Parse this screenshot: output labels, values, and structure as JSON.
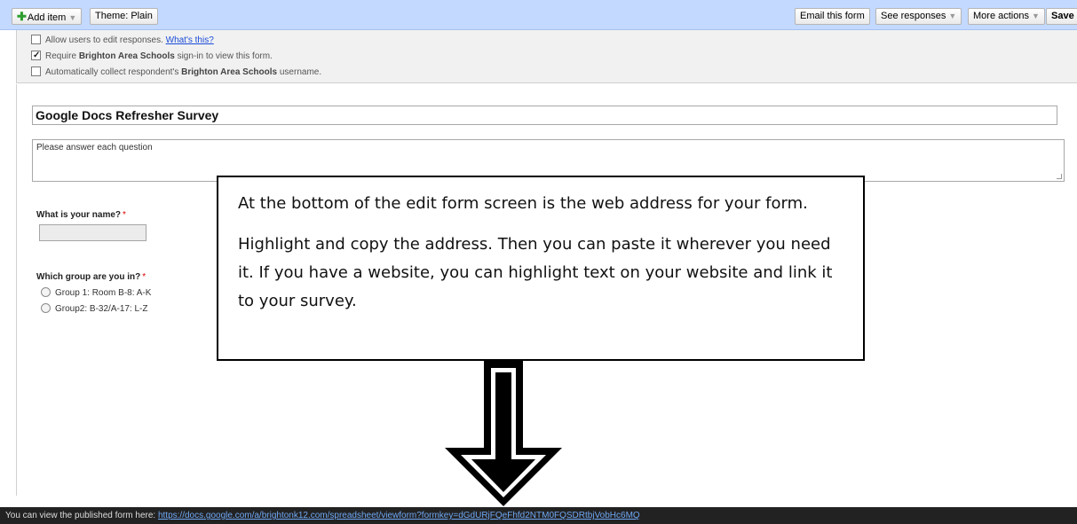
{
  "toolbar": {
    "add_item": "Add item",
    "theme": "Theme: Plain",
    "email_form": "Email this form",
    "see_responses": "See responses",
    "more_actions": "More actions",
    "save": "Save"
  },
  "settings": {
    "allow_edit_prefix": "Allow users to edit responses.",
    "allow_edit_link": "What's this?",
    "allow_edit_checked": false,
    "require_signin_prefix": "Require",
    "require_signin_org": "Brighton Area Schools",
    "require_signin_suffix": "sign-in to view this form.",
    "require_signin_checked": true,
    "collect_prefix": "Automatically collect respondent's",
    "collect_org": "Brighton Area Schools",
    "collect_suffix": "username.",
    "collect_checked": false
  },
  "form": {
    "title": "Google Docs Refresher Survey",
    "description": "Please answer each question",
    "questions": [
      {
        "label": "What is your name?",
        "required_mark": "*"
      },
      {
        "label": "Which group are you in?",
        "required_mark": "*",
        "options": [
          "Group 1: Room B-8: A-K",
          "Group2: B-32/A-17: L-Z"
        ]
      }
    ]
  },
  "callout": {
    "paragraph1": "At the bottom of the edit form screen is the web address for your form.",
    "paragraph2": "Highlight and copy the address. Then you can paste it wherever you need it. If you have a website, you can highlight text on your website and link it to your survey."
  },
  "footer": {
    "prefix": "You can view the published form here:",
    "url": "https://docs.google.com/a/brightonk12.com/spreadsheet/viewform?formkey=dGdURjFQeFhfd2NTM0FQSDRtbjVobHc6MQ"
  },
  "icons": {
    "add": "plus-icon",
    "dropdown": "caret-down-icon",
    "arrow": "down-arrow-icon"
  }
}
